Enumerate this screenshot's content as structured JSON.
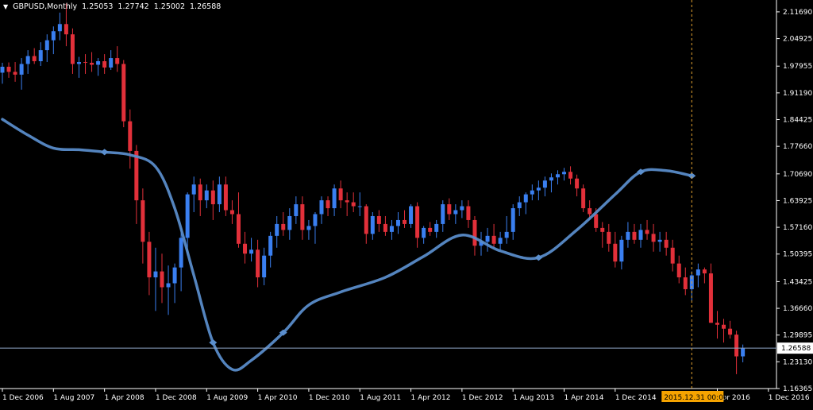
{
  "header": {
    "menu_icon": "triangle-down-icon",
    "symbol": "GBPUSD,Monthly",
    "open": "1.25053",
    "high": "1.27742",
    "low": "1.25002",
    "close": "1.26588"
  },
  "colors": {
    "background": "#000000",
    "bull": "#3a7ff0",
    "bear": "#e2303a",
    "curve": "#5b8fce",
    "axis": "#ffffff",
    "price_line": "#8fa6c8",
    "cursor_line": "#e0a030",
    "cursor_label_bg": "#f5a300"
  },
  "cursor_label": "2015.12.31 00:00",
  "price_label": "1.26588",
  "chart_data": {
    "type": "candlestick",
    "title": "GBPUSD,Monthly",
    "ylim": [
      1.1636,
      2.1469
    ],
    "y_ticks": [
      "2.11690",
      "2.04925",
      "1.97955",
      "1.91190",
      "1.84425",
      "1.77660",
      "1.70690",
      "1.63925",
      "1.57160",
      "1.50395",
      "1.43425",
      "1.36660",
      "1.29895",
      "1.23130",
      "1.16365"
    ],
    "x_ticks": [
      "1 Dec 2006",
      "1 Aug 2007",
      "1 Apr 2008",
      "1 Dec 2008",
      "1 Aug 2009",
      "1 Apr 2010",
      "1 Dec 2010",
      "1 Aug 2011",
      "1 Apr 2012",
      "1 Dec 2012",
      "1 Aug 2013",
      "1 Apr 2014",
      "1 Dec 2014",
      "Apr 2016",
      "1 Dec 2016"
    ],
    "x_tick_index": [
      0,
      8,
      16,
      24,
      32,
      40,
      48,
      56,
      64,
      72,
      80,
      88,
      96,
      112,
      120
    ],
    "highlighted_date": "2015.12.31 00:00",
    "highlighted_index": 108,
    "current_price": 1.26588,
    "curve_points": [
      [
        0,
        1.845
      ],
      [
        4,
        1.805
      ],
      [
        8,
        1.772
      ],
      [
        12,
        1.768
      ],
      [
        16,
        1.762
      ],
      [
        20,
        1.755
      ],
      [
        24,
        1.725
      ],
      [
        27,
        1.62
      ],
      [
        30,
        1.45
      ],
      [
        33,
        1.28
      ],
      [
        36,
        1.212
      ],
      [
        39,
        1.235
      ],
      [
        44,
        1.305
      ],
      [
        48,
        1.375
      ],
      [
        53,
        1.408
      ],
      [
        60,
        1.445
      ],
      [
        66,
        1.498
      ],
      [
        72,
        1.552
      ],
      [
        78,
        1.512
      ],
      [
        84,
        1.495
      ],
      [
        90,
        1.565
      ],
      [
        96,
        1.655
      ],
      [
        100,
        1.712
      ],
      [
        104,
        1.715
      ],
      [
        108,
        1.702
      ]
    ],
    "ohlc": [
      [
        1.963,
        1.988,
        1.935,
        1.978
      ],
      [
        1.978,
        1.989,
        1.95,
        1.965
      ],
      [
        1.965,
        1.99,
        1.94,
        1.958
      ],
      [
        1.958,
        2.0,
        1.92,
        1.985
      ],
      [
        1.985,
        2.02,
        1.96,
        2.005
      ],
      [
        2.005,
        2.025,
        1.985,
        1.992
      ],
      [
        1.992,
        2.04,
        1.98,
        2.02
      ],
      [
        2.02,
        2.06,
        1.99,
        2.045
      ],
      [
        2.045,
        2.08,
        2.01,
        2.068
      ],
      [
        2.068,
        2.115,
        2.045,
        2.086
      ],
      [
        2.086,
        2.138,
        2.03,
        2.06
      ],
      [
        2.06,
        2.075,
        1.96,
        1.985
      ],
      [
        1.985,
        2.003,
        1.95,
        1.99
      ],
      [
        1.99,
        2.01,
        1.96,
        1.988
      ],
      [
        1.988,
        2.015,
        1.965,
        1.983
      ],
      [
        1.983,
        2.0,
        1.955,
        1.992
      ],
      [
        1.992,
        2.01,
        1.96,
        1.976
      ],
      [
        1.976,
        2.02,
        1.97,
        2.0
      ],
      [
        2.0,
        2.03,
        1.965,
        1.985
      ],
      [
        1.985,
        1.995,
        1.825,
        1.84
      ],
      [
        1.84,
        1.87,
        1.72,
        1.765
      ],
      [
        1.765,
        1.78,
        1.58,
        1.64
      ],
      [
        1.64,
        1.67,
        1.48,
        1.535
      ],
      [
        1.535,
        1.56,
        1.4,
        1.445
      ],
      [
        1.445,
        1.52,
        1.36,
        1.46
      ],
      [
        1.46,
        1.505,
        1.38,
        1.42
      ],
      [
        1.42,
        1.475,
        1.35,
        1.43
      ],
      [
        1.43,
        1.48,
        1.38,
        1.47
      ],
      [
        1.47,
        1.57,
        1.41,
        1.545
      ],
      [
        1.545,
        1.66,
        1.5,
        1.655
      ],
      [
        1.655,
        1.7,
        1.61,
        1.68
      ],
      [
        1.68,
        1.695,
        1.6,
        1.64
      ],
      [
        1.64,
        1.68,
        1.62,
        1.665
      ],
      [
        1.665,
        1.69,
        1.59,
        1.63
      ],
      [
        1.63,
        1.7,
        1.61,
        1.68
      ],
      [
        1.68,
        1.7,
        1.6,
        1.615
      ],
      [
        1.615,
        1.64,
        1.58,
        1.605
      ],
      [
        1.605,
        1.66,
        1.52,
        1.53
      ],
      [
        1.53,
        1.56,
        1.48,
        1.505
      ],
      [
        1.505,
        1.545,
        1.485,
        1.515
      ],
      [
        1.515,
        1.54,
        1.42,
        1.445
      ],
      [
        1.445,
        1.52,
        1.425,
        1.5
      ],
      [
        1.5,
        1.56,
        1.47,
        1.55
      ],
      [
        1.55,
        1.6,
        1.52,
        1.58
      ],
      [
        1.58,
        1.61,
        1.55,
        1.565
      ],
      [
        1.565,
        1.62,
        1.54,
        1.6
      ],
      [
        1.6,
        1.65,
        1.58,
        1.63
      ],
      [
        1.63,
        1.65,
        1.54,
        1.565
      ],
      [
        1.565,
        1.59,
        1.54,
        1.575
      ],
      [
        1.575,
        1.61,
        1.53,
        1.605
      ],
      [
        1.605,
        1.65,
        1.58,
        1.64
      ],
      [
        1.64,
        1.65,
        1.6,
        1.62
      ],
      [
        1.62,
        1.68,
        1.6,
        1.67
      ],
      [
        1.67,
        1.69,
        1.62,
        1.64
      ],
      [
        1.64,
        1.66,
        1.6,
        1.635
      ],
      [
        1.635,
        1.66,
        1.61,
        1.625
      ],
      [
        1.625,
        1.66,
        1.6,
        1.625
      ],
      [
        1.625,
        1.63,
        1.53,
        1.555
      ],
      [
        1.555,
        1.61,
        1.54,
        1.6
      ],
      [
        1.6,
        1.615,
        1.56,
        1.58
      ],
      [
        1.58,
        1.6,
        1.55,
        1.56
      ],
      [
        1.56,
        1.59,
        1.54,
        1.575
      ],
      [
        1.575,
        1.61,
        1.555,
        1.59
      ],
      [
        1.59,
        1.615,
        1.57,
        1.58
      ],
      [
        1.58,
        1.63,
        1.57,
        1.625
      ],
      [
        1.625,
        1.635,
        1.52,
        1.545
      ],
      [
        1.545,
        1.575,
        1.53,
        1.57
      ],
      [
        1.57,
        1.585,
        1.55,
        1.56
      ],
      [
        1.56,
        1.59,
        1.545,
        1.58
      ],
      [
        1.58,
        1.64,
        1.56,
        1.63
      ],
      [
        1.63,
        1.645,
        1.59,
        1.605
      ],
      [
        1.605,
        1.63,
        1.58,
        1.615
      ],
      [
        1.615,
        1.64,
        1.595,
        1.625
      ],
      [
        1.625,
        1.64,
        1.57,
        1.59
      ],
      [
        1.59,
        1.6,
        1.5,
        1.525
      ],
      [
        1.525,
        1.56,
        1.5,
        1.535
      ],
      [
        1.535,
        1.57,
        1.51,
        1.55
      ],
      [
        1.55,
        1.58,
        1.52,
        1.53
      ],
      [
        1.53,
        1.56,
        1.515,
        1.545
      ],
      [
        1.545,
        1.6,
        1.53,
        1.56
      ],
      [
        1.56,
        1.63,
        1.54,
        1.62
      ],
      [
        1.62,
        1.65,
        1.6,
        1.635
      ],
      [
        1.635,
        1.66,
        1.605,
        1.655
      ],
      [
        1.655,
        1.68,
        1.64,
        1.665
      ],
      [
        1.665,
        1.69,
        1.64,
        1.672
      ],
      [
        1.672,
        1.7,
        1.65,
        1.69
      ],
      [
        1.69,
        1.708,
        1.66,
        1.698
      ],
      [
        1.698,
        1.716,
        1.68,
        1.706
      ],
      [
        1.706,
        1.722,
        1.69,
        1.712
      ],
      [
        1.712,
        1.726,
        1.68,
        1.695
      ],
      [
        1.695,
        1.705,
        1.65,
        1.67
      ],
      [
        1.67,
        1.68,
        1.61,
        1.62
      ],
      [
        1.62,
        1.64,
        1.59,
        1.605
      ],
      [
        1.605,
        1.62,
        1.56,
        1.57
      ],
      [
        1.57,
        1.585,
        1.52,
        1.56
      ],
      [
        1.56,
        1.58,
        1.51,
        1.53
      ],
      [
        1.53,
        1.56,
        1.47,
        1.485
      ],
      [
        1.485,
        1.55,
        1.465,
        1.54
      ],
      [
        1.54,
        1.585,
        1.52,
        1.56
      ],
      [
        1.56,
        1.58,
        1.53,
        1.54
      ],
      [
        1.54,
        1.58,
        1.52,
        1.565
      ],
      [
        1.565,
        1.59,
        1.54,
        1.555
      ],
      [
        1.555,
        1.58,
        1.51,
        1.535
      ],
      [
        1.535,
        1.56,
        1.51,
        1.54
      ],
      [
        1.54,
        1.56,
        1.5,
        1.52
      ],
      [
        1.52,
        1.54,
        1.46,
        1.48
      ],
      [
        1.48,
        1.5,
        1.43,
        1.445
      ],
      [
        1.445,
        1.47,
        1.4,
        1.415
      ],
      [
        1.415,
        1.46,
        1.385,
        1.45
      ],
      [
        1.45,
        1.48,
        1.42,
        1.465
      ],
      [
        1.465,
        1.47,
        1.43,
        1.455
      ],
      [
        1.455,
        1.48,
        1.33,
        1.33
      ],
      [
        1.33,
        1.36,
        1.29,
        1.325
      ],
      [
        1.325,
        1.34,
        1.28,
        1.315
      ],
      [
        1.315,
        1.335,
        1.29,
        1.3
      ],
      [
        1.3,
        1.31,
        1.2,
        1.245
      ],
      [
        1.245,
        1.275,
        1.23,
        1.265
      ]
    ]
  }
}
